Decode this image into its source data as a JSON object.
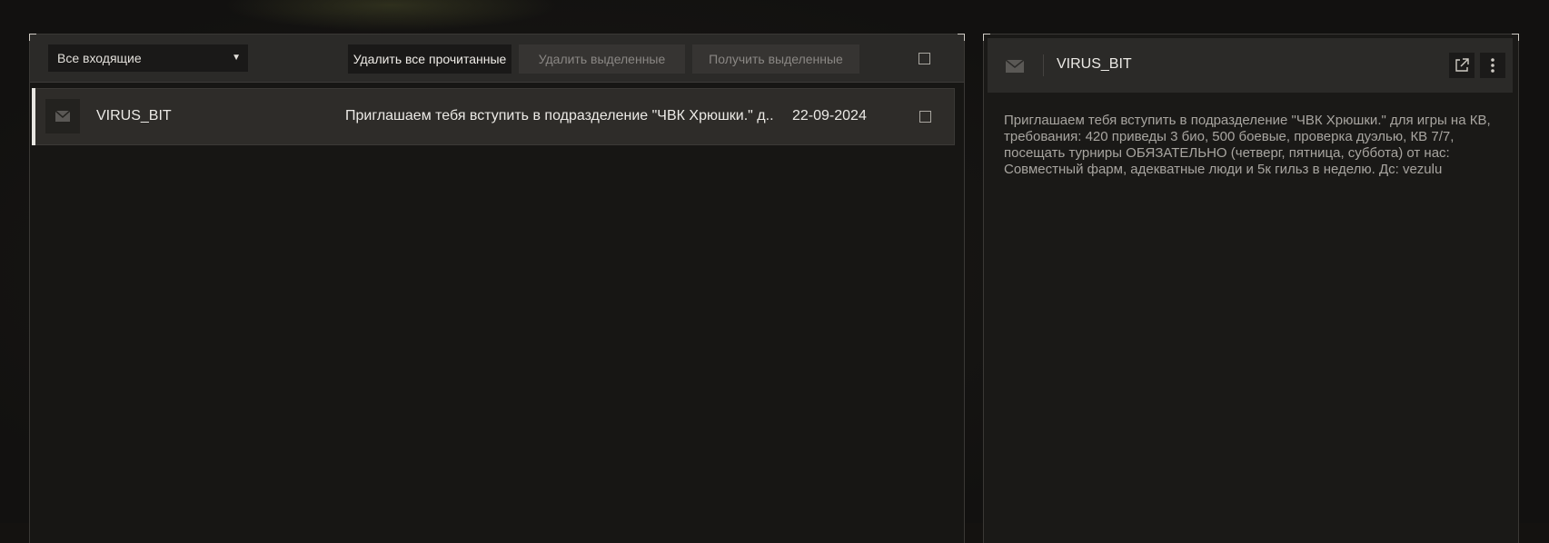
{
  "inbox": {
    "filter_selected": "Все входящие",
    "buttons": {
      "delete_all_read": "Удалить все прочитанные",
      "delete_selected": "Удалить выделенные",
      "get_selected": "Получить выделенные"
    },
    "messages": [
      {
        "sender": "VIRUS_BIT",
        "subject": "Приглашаем тебя вступить в подразделение \"ЧВК Хрюшки.\" д..",
        "date": "22-09-2024",
        "selected": true
      }
    ]
  },
  "detail": {
    "sender": "VIRUS_BIT",
    "body": "Приглашаем тебя вступить в подразделение \"ЧВК Хрюшки.\" для игры на КВ, требования: 420 приведы 3 био, 500 боевые, проверка дуэлью, КВ 7/7, посещать турниры ОБЯЗАТЕЛЬНО (четверг, пятница, суббота) от нас: Совместный фарм, адекватные люди и 5к гильз в неделю. Дс: vezulu"
  },
  "icons": {
    "envelope": "envelope-icon",
    "external_link": "external-link-icon",
    "more": "more-vertical-icon",
    "dropdown": "caret-down-icon"
  },
  "colors": {
    "accent": "#e8e6e2",
    "panel": "#2b2a28",
    "background": "#141210"
  }
}
